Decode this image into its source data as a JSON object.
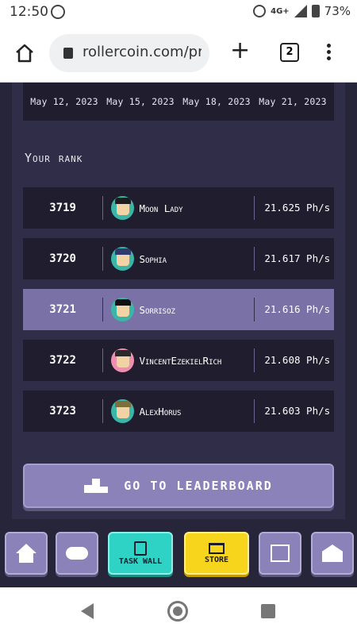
{
  "status_bar": {
    "time": "12:50",
    "network": "4G+",
    "battery": "73%"
  },
  "browser": {
    "url": "rollercoin.com/pr",
    "tab_count": "2"
  },
  "chart_axis": {
    "dates": [
      "May 12, 2023",
      "May 15, 2023",
      "May 18, 2023",
      "May 21, 2023"
    ]
  },
  "rank": {
    "title": "Your rank",
    "rows": [
      {
        "rank": "3719",
        "name": "Moon Lady",
        "power": "21.625 Ph/s",
        "highlight": false
      },
      {
        "rank": "3720",
        "name": "Sophia",
        "power": "21.617 Ph/s",
        "highlight": false
      },
      {
        "rank": "3721",
        "name": "Sorrisoz",
        "power": "21.616 Ph/s",
        "highlight": true
      },
      {
        "rank": "3722",
        "name": "VincentEzekielRich",
        "power": "21.608 Ph/s",
        "highlight": false
      },
      {
        "rank": "3723",
        "name": "AlexHorus",
        "power": "21.603 Ph/s",
        "highlight": false
      }
    ]
  },
  "leaderboard_button": {
    "label": "GO TO LEADERBOARD"
  },
  "app_nav": {
    "task_wall_label": "TASK WALL",
    "store_label": "STORE"
  },
  "colors": {
    "accent": "#8a82b8",
    "highlight_row": "#7a72a6",
    "task_wall": "#2fd3c6",
    "store": "#f7d51c",
    "background": "#27253a"
  },
  "icons": [
    "home-icon",
    "gamepad-icon",
    "clipboard-icon",
    "cart-icon",
    "shop-icon",
    "garage-icon",
    "podium-icon"
  ]
}
